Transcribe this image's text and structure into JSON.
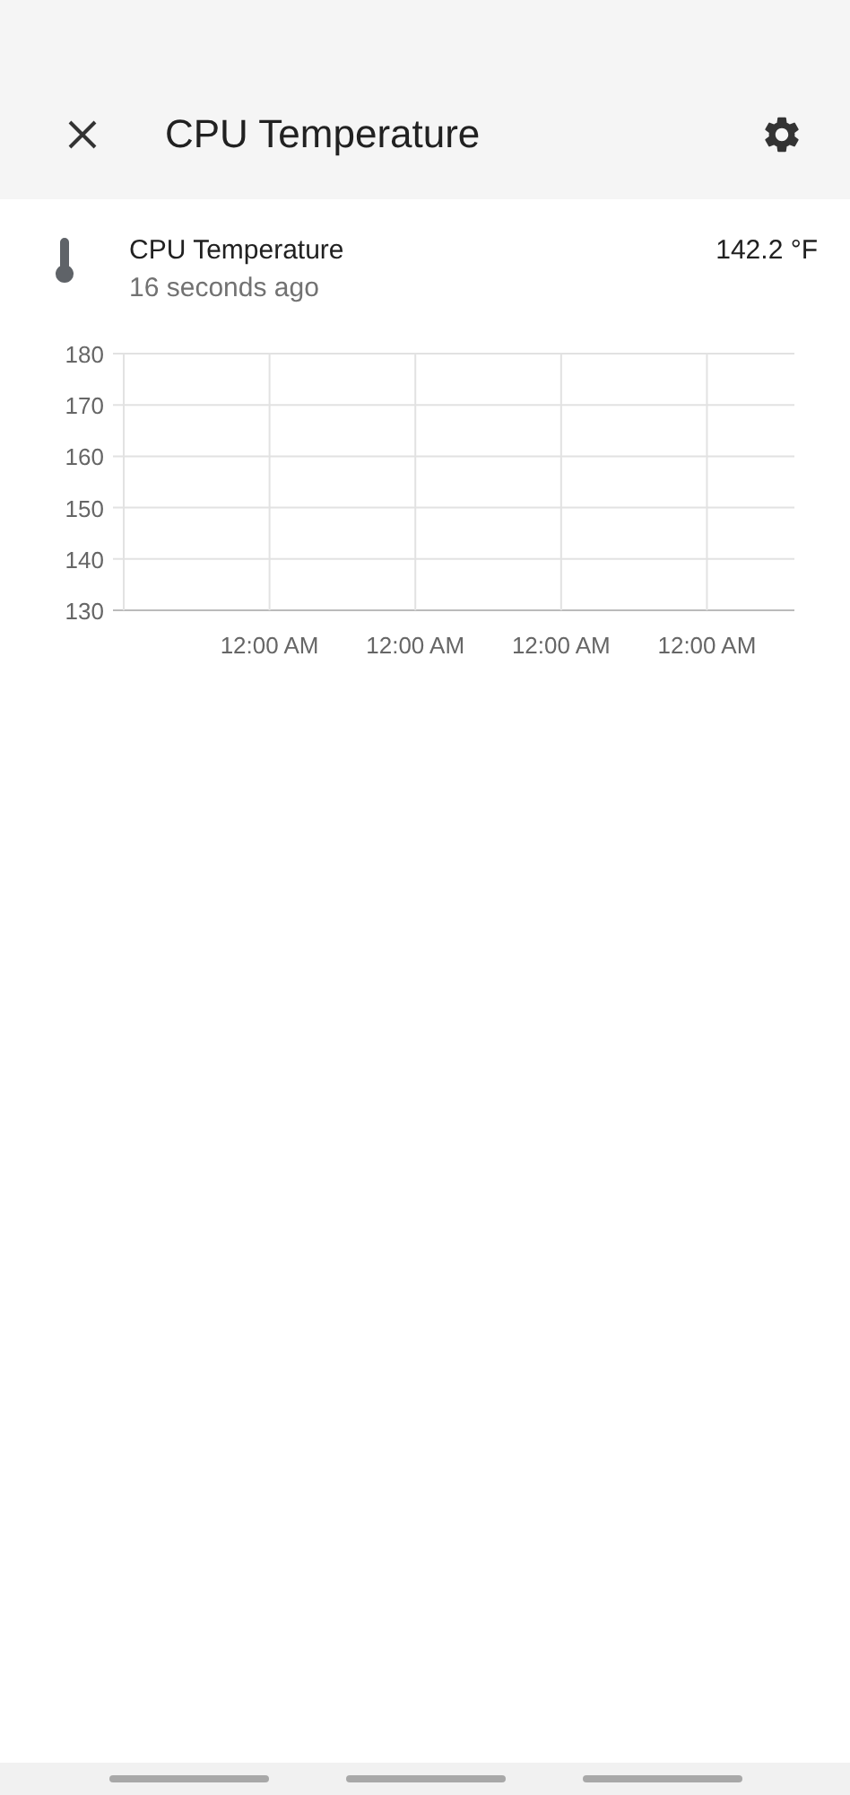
{
  "header": {
    "title": "CPU Temperature"
  },
  "entity": {
    "name": "CPU Temperature",
    "updated": "16 seconds ago",
    "state": "142.2 °F"
  },
  "chart_data": {
    "type": "line",
    "grid": true,
    "ylim": [
      130,
      180
    ],
    "yticks": [
      130,
      140,
      150,
      160,
      170,
      180
    ],
    "xticks": [
      {
        "value": 1,
        "label": "12:00 AM"
      },
      {
        "value": 2,
        "label": "12:00 AM"
      },
      {
        "value": 3,
        "label": "12:00 AM"
      },
      {
        "value": 4,
        "label": "12:00 AM"
      }
    ],
    "xlim": [
      0,
      4.6
    ]
  }
}
